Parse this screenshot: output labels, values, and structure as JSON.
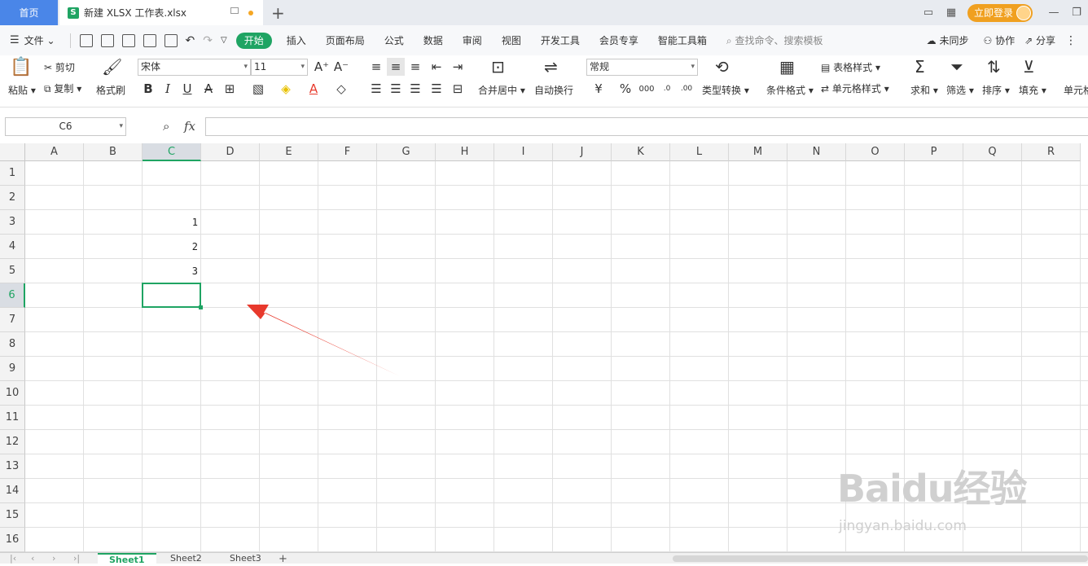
{
  "titlebar": {
    "home_tab": "首页",
    "doc_tab": "新建 XLSX 工作表.xlsx",
    "login": "立即登录"
  },
  "menu": {
    "file": "文件",
    "tabs": [
      "开始",
      "插入",
      "页面布局",
      "公式",
      "数据",
      "审阅",
      "视图",
      "开发工具",
      "会员专享",
      "智能工具箱"
    ],
    "search_placeholder": "查找命令、搜索模板",
    "sync": "未同步",
    "collab": "协作",
    "share": "分享"
  },
  "ribbon": {
    "paste": "粘贴",
    "cut": "剪切",
    "copy": "复制",
    "format_painter": "格式刷",
    "font_name": "宋体",
    "font_size": "11",
    "merge_center": "合并居中",
    "wrap_text": "自动换行",
    "number_format": "常规",
    "type_convert": "类型转换",
    "cond_format": "条件格式",
    "table_style": "表格样式",
    "cell_style": "单元格样式",
    "sum": "求和",
    "filter": "筛选",
    "sort": "排序",
    "fill": "填充",
    "cell_partial": "单元格"
  },
  "formula_bar": {
    "name_box": "C6",
    "fx_label": "fx",
    "formula": ""
  },
  "sheet": {
    "columns": [
      "A",
      "B",
      "C",
      "D",
      "E",
      "F",
      "G",
      "H",
      "I",
      "J",
      "K",
      "L",
      "M",
      "N",
      "O",
      "P",
      "Q",
      "R"
    ],
    "rows": [
      "1",
      "2",
      "3",
      "4",
      "5",
      "6",
      "7",
      "8",
      "9",
      "10",
      "11",
      "12",
      "13",
      "14",
      "15",
      "16"
    ],
    "selected_col": "C",
    "selected_row": "6",
    "cells": [
      {
        "ref": "C3",
        "value": "1"
      },
      {
        "ref": "C4",
        "value": "2"
      },
      {
        "ref": "C5",
        "value": "3"
      }
    ]
  },
  "sheet_tabs": [
    "Sheet1",
    "Sheet2",
    "Sheet3"
  ],
  "watermark": {
    "logo": "Baidu经验",
    "sub": "jingyan.baidu.com"
  },
  "colors": {
    "accent": "#1fa463",
    "home_tab": "#4a86e8",
    "arrow": "#e8392c",
    "login": "#f0a020"
  }
}
